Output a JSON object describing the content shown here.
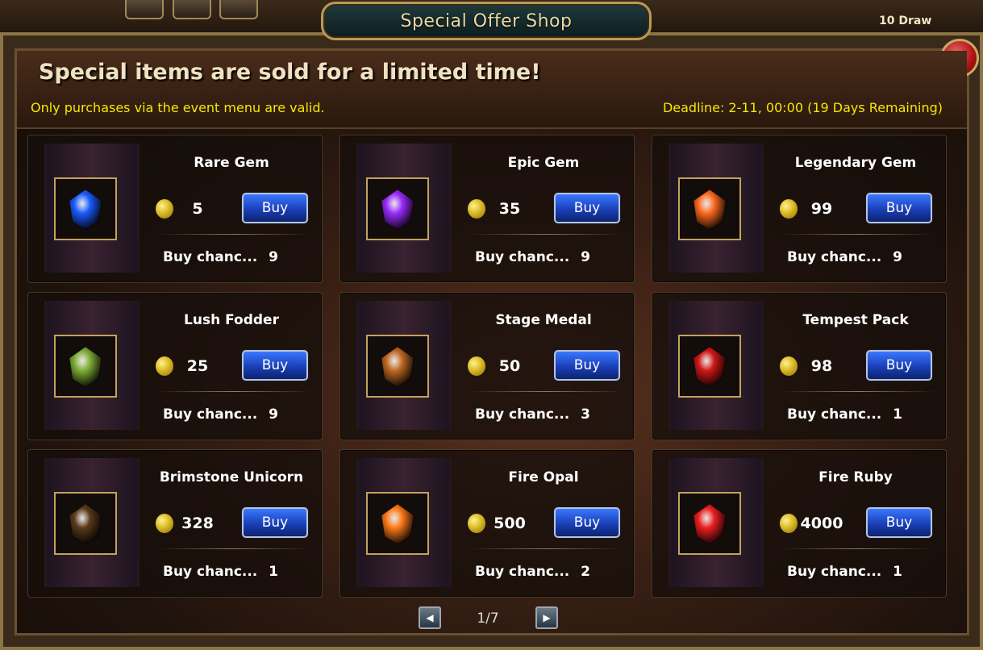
{
  "window": {
    "title": "Special Offer Shop",
    "top_right_label": "10 Draw"
  },
  "header": {
    "headline": "Special items are sold for a limited time!",
    "note": "Only purchases via the event menu are valid.",
    "deadline": "Deadline: 2-11, 00:00 (19 Days Remaining)"
  },
  "buy_label": "Buy",
  "chance_label": "Buy chanc...",
  "items": [
    {
      "name": "Rare Gem",
      "price": "5",
      "chance": "9",
      "icon": "rare-gem-icon",
      "color": "#1a5cff"
    },
    {
      "name": "Epic Gem",
      "price": "35",
      "chance": "9",
      "icon": "epic-gem-icon",
      "color": "#9b2cff"
    },
    {
      "name": "Legendary Gem",
      "price": "99",
      "chance": "9",
      "icon": "legendary-gem-icon",
      "color": "#ff6a1f"
    },
    {
      "name": "Lush Fodder",
      "price": "25",
      "chance": "9",
      "icon": "fodder-icon",
      "color": "#7fae34"
    },
    {
      "name": "Stage Medal",
      "price": "50",
      "chance": "3",
      "icon": "medal-icon",
      "color": "#c06a24"
    },
    {
      "name": "Tempest Pack",
      "price": "98",
      "chance": "1",
      "icon": "pack-icon",
      "color": "#d01818"
    },
    {
      "name": "Brimstone Unicorn",
      "price": "328",
      "chance": "1",
      "icon": "unicorn-icon",
      "color": "#5a3a1a"
    },
    {
      "name": "Fire Opal",
      "price": "500",
      "chance": "2",
      "icon": "fire-opal-icon",
      "color": "#ff7a1a"
    },
    {
      "name": "Fire Ruby",
      "price": "4000",
      "chance": "1",
      "icon": "fire-ruby-icon",
      "color": "#ee2020"
    }
  ],
  "pagination": {
    "page": "1/7"
  }
}
